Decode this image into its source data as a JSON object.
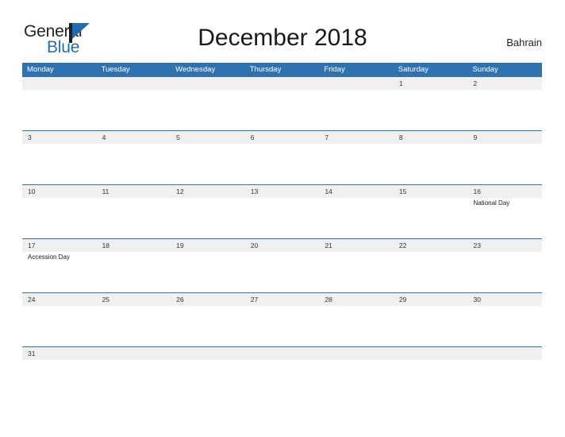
{
  "logo": {
    "word_top": "General",
    "word_bottom": "Blue",
    "flag_icon": "triangle-flag-icon",
    "color_dark": "#231f20",
    "color_blue": "#1f6cb0"
  },
  "header": {
    "title": "December 2018",
    "region": "Bahrain"
  },
  "theme": {
    "header_blue": "#2f72b0",
    "row_gray": "#f0f0f0",
    "rule_blue": "#2f72b0"
  },
  "calendar": {
    "month": "December",
    "year": "2018",
    "weekday_headers": [
      "Monday",
      "Tuesday",
      "Wednesday",
      "Thursday",
      "Friday",
      "Saturday",
      "Sunday"
    ],
    "weeks": [
      {
        "days": [
          {
            "number": "",
            "event": ""
          },
          {
            "number": "",
            "event": ""
          },
          {
            "number": "",
            "event": ""
          },
          {
            "number": "",
            "event": ""
          },
          {
            "number": "",
            "event": ""
          },
          {
            "number": "1",
            "event": ""
          },
          {
            "number": "2",
            "event": ""
          }
        ]
      },
      {
        "days": [
          {
            "number": "3",
            "event": ""
          },
          {
            "number": "4",
            "event": ""
          },
          {
            "number": "5",
            "event": ""
          },
          {
            "number": "6",
            "event": ""
          },
          {
            "number": "7",
            "event": ""
          },
          {
            "number": "8",
            "event": ""
          },
          {
            "number": "9",
            "event": ""
          }
        ]
      },
      {
        "days": [
          {
            "number": "10",
            "event": ""
          },
          {
            "number": "11",
            "event": ""
          },
          {
            "number": "12",
            "event": ""
          },
          {
            "number": "13",
            "event": ""
          },
          {
            "number": "14",
            "event": ""
          },
          {
            "number": "15",
            "event": ""
          },
          {
            "number": "16",
            "event": "National Day"
          }
        ]
      },
      {
        "days": [
          {
            "number": "17",
            "event": "Accession Day"
          },
          {
            "number": "18",
            "event": ""
          },
          {
            "number": "19",
            "event": ""
          },
          {
            "number": "20",
            "event": ""
          },
          {
            "number": "21",
            "event": ""
          },
          {
            "number": "22",
            "event": ""
          },
          {
            "number": "23",
            "event": ""
          }
        ]
      },
      {
        "days": [
          {
            "number": "24",
            "event": ""
          },
          {
            "number": "25",
            "event": ""
          },
          {
            "number": "26",
            "event": ""
          },
          {
            "number": "27",
            "event": ""
          },
          {
            "number": "28",
            "event": ""
          },
          {
            "number": "29",
            "event": ""
          },
          {
            "number": "30",
            "event": ""
          }
        ]
      },
      {
        "days": [
          {
            "number": "31",
            "event": ""
          },
          {
            "number": "",
            "event": ""
          },
          {
            "number": "",
            "event": ""
          },
          {
            "number": "",
            "event": ""
          },
          {
            "number": "",
            "event": ""
          },
          {
            "number": "",
            "event": ""
          },
          {
            "number": "",
            "event": ""
          }
        ]
      }
    ]
  }
}
